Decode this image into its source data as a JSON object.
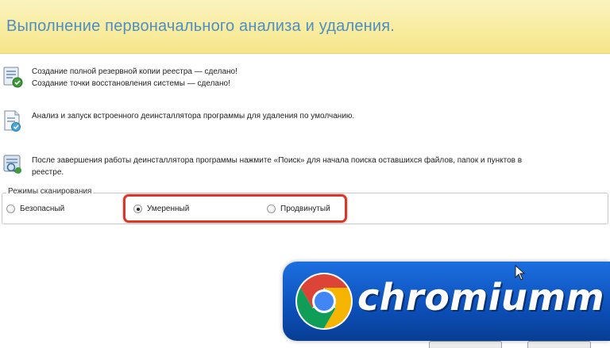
{
  "header": {
    "title": "Выполнение первоначального анализа и удаления."
  },
  "steps": [
    {
      "icon": "registry-backup-icon",
      "lines": [
        "Создание полной резервной копии реестра — сделано!",
        "Создание точки восстановления системы — сделано!"
      ]
    },
    {
      "icon": "uninstaller-check-icon",
      "lines": [
        "Анализ и запуск встроенного деинсталлятора программы для удаления по умолчанию."
      ]
    },
    {
      "icon": "search-leftovers-icon",
      "lines": [
        "После завершения работы деинсталлятора программы нажмите «Поиск» для начала поиска оставшихся файлов, папок и пунктов в",
        "реестре."
      ]
    }
  ],
  "scan_modes": {
    "legend": "Режимы сканирования",
    "options": [
      {
        "label": "Безопасный",
        "checked": false
      },
      {
        "label": "Умеренный",
        "checked": true
      },
      {
        "label": "Продвинутый",
        "checked": false
      }
    ]
  },
  "watermark": {
    "text": "chromiumm"
  },
  "colors": {
    "header_bg": "#f8ec9f",
    "title_blue": "#4d8ec4",
    "highlight_red": "#d9362c",
    "watermark_blue": "#0c4fb8"
  }
}
